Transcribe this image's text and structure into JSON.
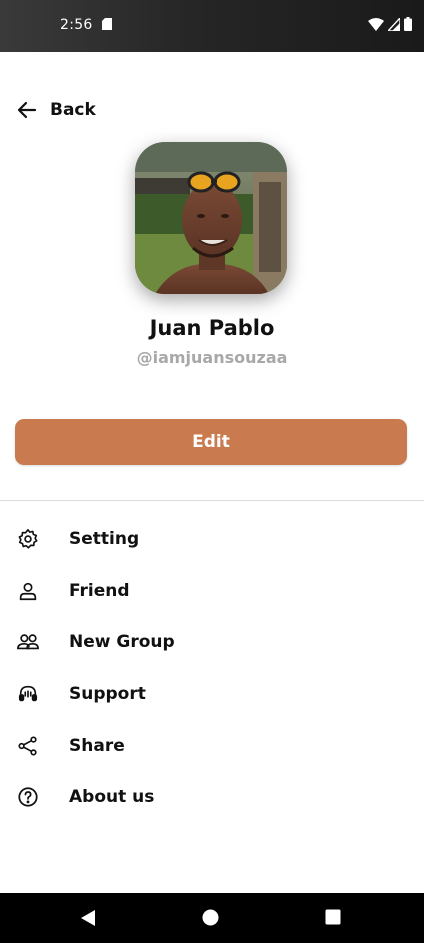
{
  "status_bar": {
    "time": "2:56",
    "icons": [
      "sd-card-icon",
      "wifi-icon",
      "signal-icon",
      "battery-icon"
    ]
  },
  "header": {
    "back_label": "Back",
    "back_icon": "arrow-left-icon"
  },
  "profile": {
    "name": "Juan Pablo",
    "handle": "@iamjuansouzaa"
  },
  "actions": {
    "edit_label": "Edit",
    "edit_color": "#c97b4f"
  },
  "menu": {
    "items": [
      {
        "label": "Setting",
        "icon": "gear-icon"
      },
      {
        "label": "Friend",
        "icon": "person-icon"
      },
      {
        "label": "New Group",
        "icon": "group-icon"
      },
      {
        "label": "Support",
        "icon": "headset-icon"
      },
      {
        "label": "Share",
        "icon": "share-icon"
      },
      {
        "label": "About us",
        "icon": "help-circle-icon"
      }
    ]
  },
  "nav_bar": {
    "buttons": [
      "back-triangle-icon",
      "home-circle-icon",
      "recents-square-icon"
    ]
  }
}
